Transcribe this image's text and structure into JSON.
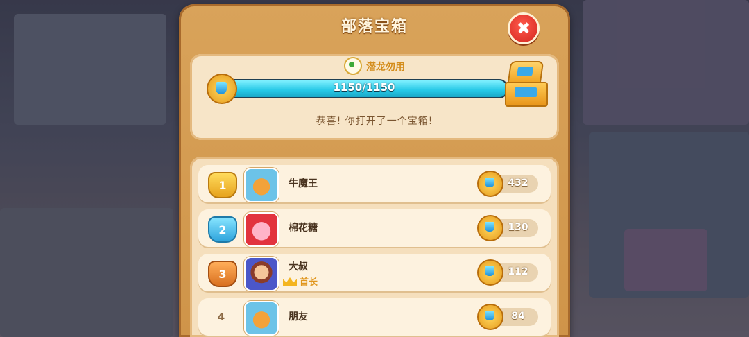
{
  "dialog": {
    "title": "部落宝箱",
    "close_label": "✖"
  },
  "progress": {
    "tribe_name": "潜龙勿用",
    "current": 1150,
    "goal": 1150,
    "text": "1150/1150",
    "fill_fraction": 1.0,
    "message": "恭喜! 你打开了一个宝箱!"
  },
  "members": [
    {
      "rank": "1",
      "medal": "gold",
      "avatar": "tiger-avatar",
      "name": "牛魔王",
      "role": "",
      "score": "432"
    },
    {
      "rank": "2",
      "medal": "silver",
      "avatar": "pig-avatar",
      "name": "棉花糖",
      "role": "",
      "score": "130"
    },
    {
      "rank": "3",
      "medal": "bronze",
      "avatar": "man-avatar",
      "name": "大叔",
      "role": "首长",
      "score": "112"
    },
    {
      "rank": "4",
      "medal": "plain",
      "avatar": "tiger-avatar",
      "name": "朋友",
      "role": "",
      "score": "84"
    }
  ],
  "colors": {
    "panel": "#d9a35a",
    "bar_fill": "#26c8e6",
    "close_button": "#d3261f"
  }
}
